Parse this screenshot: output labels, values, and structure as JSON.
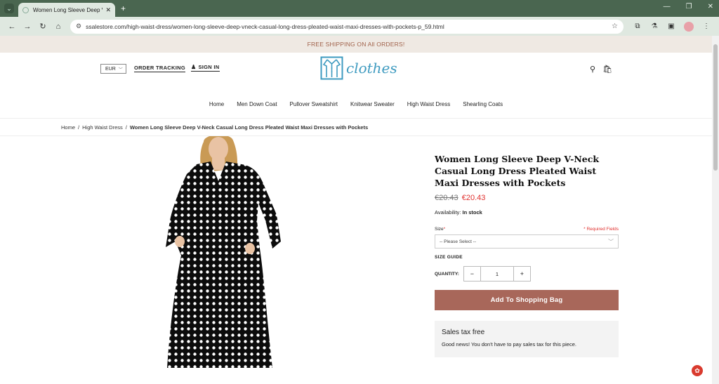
{
  "browser": {
    "tab_title": "Women Long Sleeve Deep V-N",
    "url": "ssalestore.com/high-waist-dress/women-long-sleeve-deep-vneck-casual-long-dress-pleated-waist-maxi-dresses-with-pockets-p_59.html"
  },
  "promo": "FREE SHIPPING ON All ORDERS!",
  "header": {
    "currency": "EUR",
    "order_tracking": "ORDER TRACKING",
    "sign_in": "SIGN IN",
    "logo_text": "clothes"
  },
  "nav": [
    "Home",
    "Men Down Coat",
    "Pullover Sweatshirt",
    "Knitwear Sweater",
    "High Waist Dress",
    "Shearling Coats"
  ],
  "breadcrumb": {
    "home": "Home",
    "category": "High Waist Dress",
    "current": "Women Long Sleeve Deep V-Neck Casual Long Dress Pleated Waist Maxi Dresses with Pockets"
  },
  "product": {
    "title": "Women Long Sleeve Deep V-Neck Casual Long Dress Pleated Waist Maxi Dresses with Pockets",
    "old_price": "€20.43",
    "price": "€20.43",
    "availability_label": "Availability:",
    "availability_value": "In stock",
    "size_label": "Size",
    "required_note": "* Required Fields",
    "size_placeholder": "-- Please Select --",
    "size_guide": "SIZE GUIDE",
    "quantity_label": "QUANTITY:",
    "quantity": "1",
    "add_button": "Add To Shopping Bag",
    "tax_title": "Sales tax free",
    "tax_text": "Good news! You don't have to pay sales tax for this piece."
  },
  "colors": {
    "chrome": "#4a6650",
    "accent": "#a8675a",
    "sale": "#e0312f",
    "logo": "#3f9bc0"
  }
}
